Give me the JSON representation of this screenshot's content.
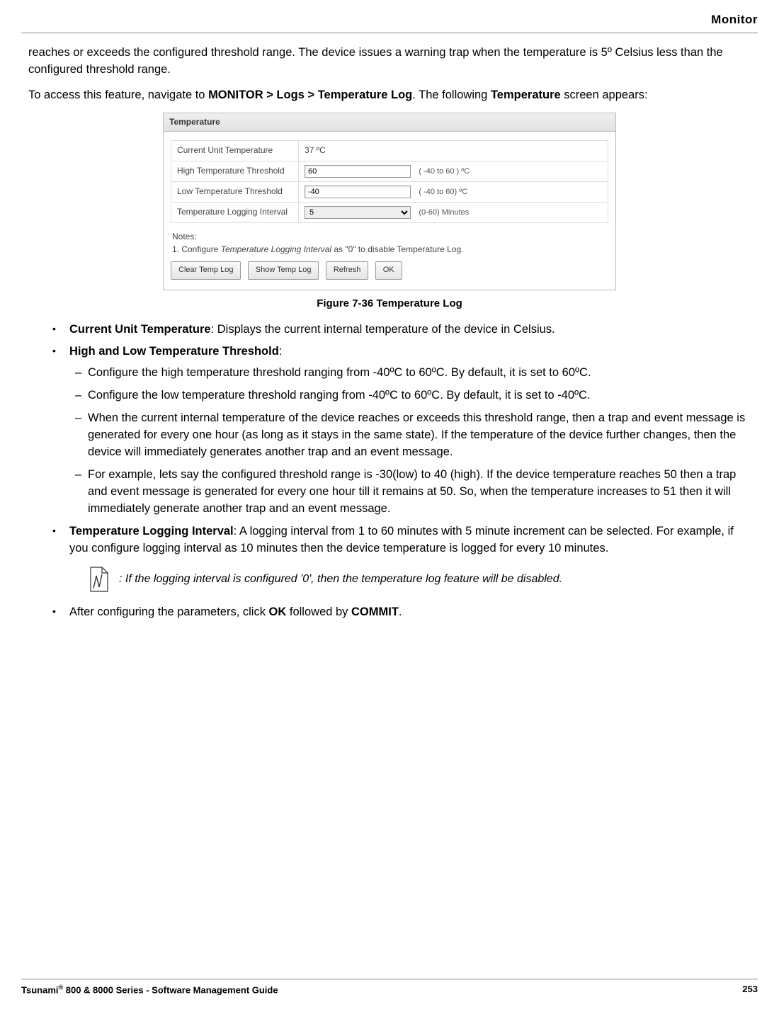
{
  "header": {
    "section": "Monitor"
  },
  "intro": {
    "p1": "reaches or exceeds the configured threshold range. The device issues a warning trap when the temperature is 5º Celsius less than the configured threshold range.",
    "p2_a": "To access this feature, navigate to ",
    "p2_b": "MONITOR > Logs > Temperature Log",
    "p2_c": ". The following ",
    "p2_d": "Temperature",
    "p2_e": " screen appears:"
  },
  "panel": {
    "title": "Temperature",
    "rows": {
      "r1_label": "Current Unit Temperature",
      "r1_value": "37  ºC",
      "r2_label": "High Temperature Threshold",
      "r2_value": "60",
      "r2_hint": "( -40 to 60 ) ºC",
      "r3_label": "Low Temperature Threshold",
      "r3_value": "-40",
      "r3_hint": "( -40 to 60) ºC",
      "r4_label": "Temperature Logging Interval",
      "r4_value": "5",
      "r4_hint": "(0-60) Minutes"
    },
    "notes_label": "Notes:",
    "notes_1a": "1. Configure ",
    "notes_1b": "Temperature Logging Interval",
    "notes_1c": " as \"0\" to disable Temperature Log.",
    "buttons": {
      "clear": "Clear Temp Log",
      "show": "Show Temp Log",
      "refresh": "Refresh",
      "ok": "OK"
    }
  },
  "figure_caption": "Figure 7-36 Temperature Log",
  "bullets": {
    "b1_a": "Current Unit Temperature",
    "b1_b": ": Displays the current internal temperature of the device in Celsius.",
    "b2_a": "High and Low Temperature Threshold",
    "b2_b": ":",
    "b2_s1": "Configure the high temperature threshold ranging from -40ºC to 60ºC. By default, it is set to 60ºC.",
    "b2_s2": "Configure the low temperature threshold ranging from -40ºC to 60ºC. By default, it is set to -40ºC.",
    "b2_s3": "When the current internal temperature of the device reaches or exceeds this threshold range, then a trap and event message is generated for every one hour (as long as it stays in the same state). If the temperature of the device further changes, then the device will immediately generates another trap and an event message.",
    "b2_s4": "For example, lets say the configured threshold range is -30(low) to 40 (high). If the device temperature reaches 50 then a trap and event message is generated for every one hour till it remains at 50. So, when the temperature increases to 51 then it will immediately generate another trap and an event message.",
    "b3_a": "Temperature Logging Interval",
    "b3_b": ": A logging interval from 1 to 60 minutes with 5 minute increment can be selected. For example, if you configure logging interval as 10 minutes then the device temperature is logged for every 10 minutes.",
    "note": ": If the logging interval is configured '0', then the temperature log feature will be disabled.",
    "b4_a": "After configuring the parameters, click ",
    "b4_b": "OK",
    "b4_c": " followed by ",
    "b4_d": "COMMIT",
    "b4_e": "."
  },
  "footer": {
    "left_a": "Tsunami",
    "left_b": "®",
    "left_c": " 800 & 8000 Series - Software Management Guide",
    "page": "253"
  }
}
